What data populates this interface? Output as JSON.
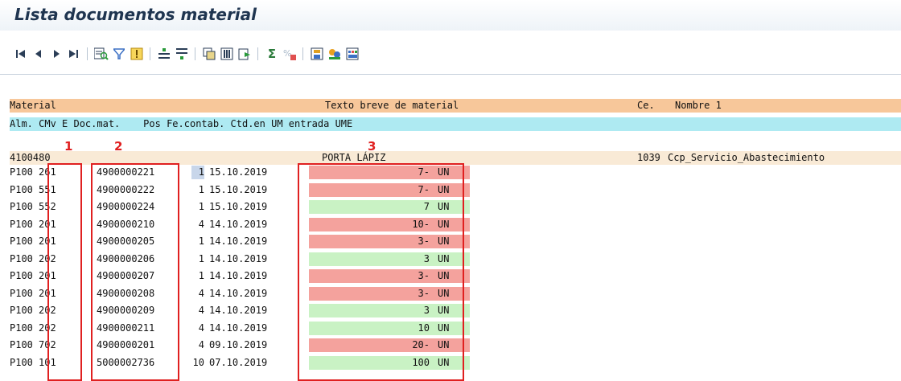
{
  "title": "Lista documentos material",
  "toolbar": {
    "icons": [
      "first-page-icon",
      "previous-page-icon",
      "next-page-icon",
      "last-page-icon",
      "details-icon",
      "filter-icon",
      "exception-icon",
      "sort-ascending-icon",
      "sort-descending-icon",
      "print-preview-icon",
      "change-layout-icon",
      "export-icon",
      "sum-icon",
      "subtotal-icon",
      "save-layout-icon",
      "abc-analysis-icon",
      "display-grid-icon"
    ]
  },
  "header": {
    "row1_col1": "Material",
    "row1_col2": "Texto breve de material",
    "row1_col3": "Ce.",
    "row1_col4": "Nombre 1",
    "row2": "Alm. CMv E Doc.mat.    Pos Fe.contab. Ctd.en UM entrada UME"
  },
  "material_row": {
    "material": "4100480",
    "description": "PORTA LÁPIZ",
    "plant": "1039",
    "name": "Ccp_Servicio_Abastecimiento"
  },
  "rows": [
    {
      "alm": "P100",
      "cmv": "261",
      "doc": "4900000221",
      "pos": "1",
      "date": "15.10.2019",
      "qty": "7-",
      "ume": "UN",
      "sign": "neg"
    },
    {
      "alm": "P100",
      "cmv": "551",
      "doc": "4900000222",
      "pos": "1",
      "date": "15.10.2019",
      "qty": "7-",
      "ume": "UN",
      "sign": "neg"
    },
    {
      "alm": "P100",
      "cmv": "552",
      "doc": "4900000224",
      "pos": "1",
      "date": "15.10.2019",
      "qty": "7",
      "ume": "UN",
      "sign": "pos"
    },
    {
      "alm": "P100",
      "cmv": "201",
      "doc": "4900000210",
      "pos": "4",
      "date": "14.10.2019",
      "qty": "10-",
      "ume": "UN",
      "sign": "neg"
    },
    {
      "alm": "P100",
      "cmv": "201",
      "doc": "4900000205",
      "pos": "1",
      "date": "14.10.2019",
      "qty": "3-",
      "ume": "UN",
      "sign": "neg"
    },
    {
      "alm": "P100",
      "cmv": "202",
      "doc": "4900000206",
      "pos": "1",
      "date": "14.10.2019",
      "qty": "3",
      "ume": "UN",
      "sign": "pos"
    },
    {
      "alm": "P100",
      "cmv": "201",
      "doc": "4900000207",
      "pos": "1",
      "date": "14.10.2019",
      "qty": "3-",
      "ume": "UN",
      "sign": "neg"
    },
    {
      "alm": "P100",
      "cmv": "201",
      "doc": "4900000208",
      "pos": "4",
      "date": "14.10.2019",
      "qty": "3-",
      "ume": "UN",
      "sign": "neg"
    },
    {
      "alm": "P100",
      "cmv": "202",
      "doc": "4900000209",
      "pos": "4",
      "date": "14.10.2019",
      "qty": "3",
      "ume": "UN",
      "sign": "pos"
    },
    {
      "alm": "P100",
      "cmv": "202",
      "doc": "4900000211",
      "pos": "4",
      "date": "14.10.2019",
      "qty": "10",
      "ume": "UN",
      "sign": "pos"
    },
    {
      "alm": "P100",
      "cmv": "702",
      "doc": "4900000201",
      "pos": "4",
      "date": "09.10.2019",
      "qty": "20-",
      "ume": "UN",
      "sign": "neg"
    },
    {
      "alm": "P100",
      "cmv": "101",
      "doc": "5000002736",
      "pos": "10",
      "date": "07.10.2019",
      "qty": "100",
      "ume": "UN",
      "sign": "pos"
    }
  ],
  "annotations": {
    "n1": "1",
    "n2": "2",
    "n3": "3"
  },
  "colors": {
    "negative": "#f4a29d",
    "positive": "#c9f2c4",
    "header1": "#f7c79a",
    "header2": "#aeeaf2",
    "annotation": "#e02020"
  }
}
